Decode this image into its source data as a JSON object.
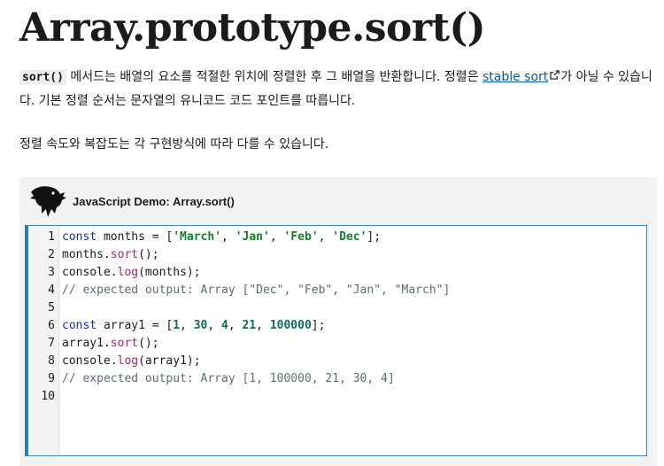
{
  "page": {
    "title": "Array.prototype.sort()"
  },
  "intro": {
    "code_term": "sort()",
    "text_before_link": " 메서드는 배열의 요소를 적절한 위치에 정렬한 후 그 배열을 반환합니다. 정렬은 ",
    "link_text": "stable sort",
    "text_after_link": "가 아닐 수 있습니다. 기본 정렬 순서는 문자열의 유니코드 코드 포인트를 따릅니다."
  },
  "note": {
    "text": "정렬 속도와 복잡도는 각 구현방식에 따라 다를 수 있습니다."
  },
  "demo": {
    "title": "JavaScript Demo: Array.sort()",
    "logo_icon": "dinosaur-logo-icon",
    "link_icon": "external-link-icon",
    "lines": [
      [
        {
          "t": "const",
          "c": "kw"
        },
        {
          "t": " months = ["
        },
        {
          "t": "'March'",
          "c": "str"
        },
        {
          "t": ", "
        },
        {
          "t": "'Jan'",
          "c": "str"
        },
        {
          "t": ", "
        },
        {
          "t": "'Feb'",
          "c": "str"
        },
        {
          "t": ", "
        },
        {
          "t": "'Dec'",
          "c": "str"
        },
        {
          "t": "];"
        }
      ],
      [
        {
          "t": "months."
        },
        {
          "t": "sort",
          "c": "fn"
        },
        {
          "t": "();"
        }
      ],
      [
        {
          "t": "console."
        },
        {
          "t": "log",
          "c": "fn"
        },
        {
          "t": "(months);"
        }
      ],
      [
        {
          "t": "// expected output: Array [\"Dec\", \"Feb\", \"Jan\", \"March\"]",
          "c": "cmt"
        }
      ],
      [],
      [
        {
          "t": "const",
          "c": "kw"
        },
        {
          "t": " array1 = ["
        },
        {
          "t": "1",
          "c": "num"
        },
        {
          "t": ", "
        },
        {
          "t": "30",
          "c": "num"
        },
        {
          "t": ", "
        },
        {
          "t": "4",
          "c": "num"
        },
        {
          "t": ", "
        },
        {
          "t": "21",
          "c": "num"
        },
        {
          "t": ", "
        },
        {
          "t": "100000",
          "c": "num"
        },
        {
          "t": "];"
        }
      ],
      [
        {
          "t": "array1."
        },
        {
          "t": "sort",
          "c": "fn"
        },
        {
          "t": "();"
        }
      ],
      [
        {
          "t": "console."
        },
        {
          "t": "log",
          "c": "fn"
        },
        {
          "t": "(array1);"
        }
      ],
      [
        {
          "t": "// expected output: Array [1, 100000, 21, 30, 4]",
          "c": "cmt"
        }
      ],
      []
    ],
    "line_numbers": [
      "1",
      "2",
      "3",
      "4",
      "5",
      "6",
      "7",
      "8",
      "9",
      "10"
    ]
  },
  "colors": {
    "link": "#0a5a9b",
    "editor_border": "#2b7fa8",
    "keyword": "#1a2fb0",
    "string": "#15802b",
    "number": "#0b6e5a",
    "function": "#a3256a",
    "comment": "#5e6c78"
  }
}
